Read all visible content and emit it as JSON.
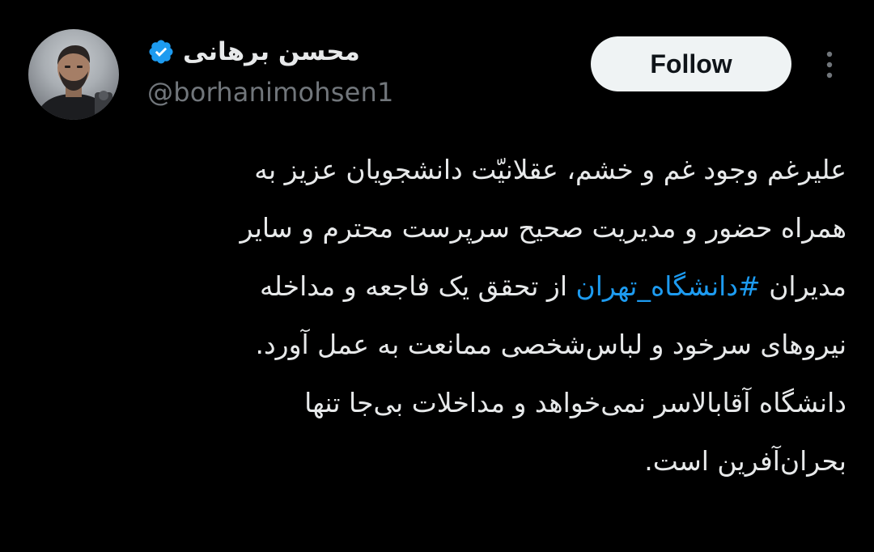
{
  "author": {
    "display_name": "محسن برهانی",
    "handle": "@borhanimohsen1",
    "verified": true,
    "verified_color": "#1d9bf0"
  },
  "actions": {
    "follow_label": "Follow"
  },
  "tweet": {
    "line1": "علیرغم وجود غم و خشم، عقلانیّت دانشجویان عزیز به",
    "line2": "همراه حضور و مدیریت صحیح سرپرست محترم و سایر",
    "line3_before": "مدیران ",
    "line3_hashtag": "#دانشگاه_تهران",
    "line3_after": " از تحقق یک فاجعه و مداخله",
    "line4": "نیروهای سرخود و لباس‌شخصی ممانعت به عمل آورد.",
    "line5": "دانشگاه آقابالاسر نمی‌خواهد و مداخلات بی‌جا تنها",
    "line6": "بحران‌آفرین است."
  },
  "colors": {
    "background": "#000000",
    "text": "#e7e9ea",
    "secondary_text": "#71767b",
    "link": "#1d9bf0",
    "follow_bg": "#eff3f4"
  }
}
